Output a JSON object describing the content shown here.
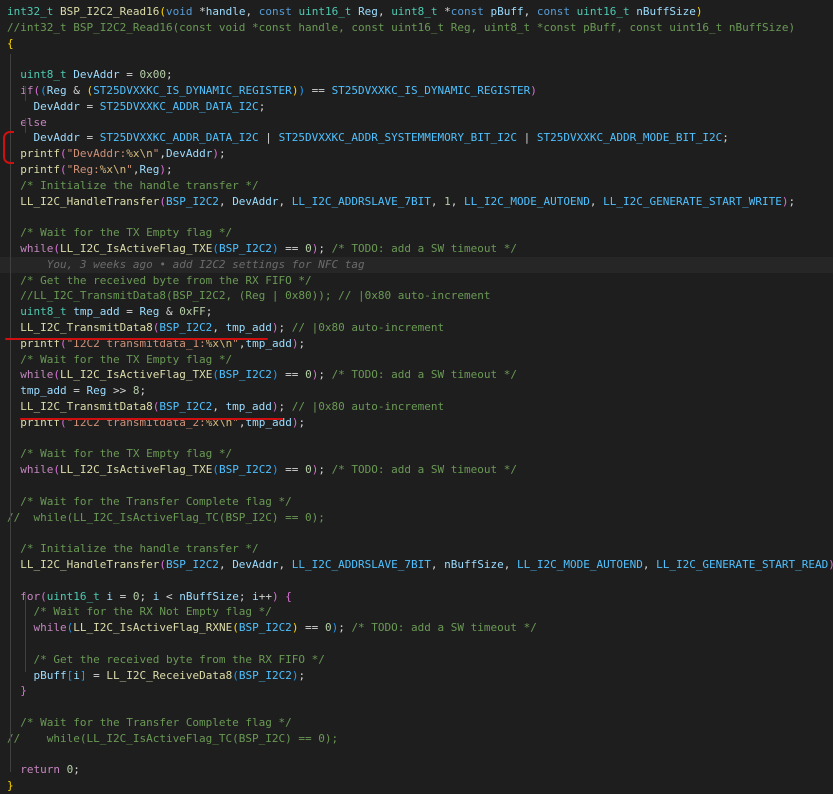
{
  "editor": {
    "colors": {
      "background": "#1e1e1e",
      "text": "#d4d4d4",
      "keyword": "#569cd6",
      "type": "#4ec9b0",
      "function": "#dcdcaa",
      "variable": "#9cdcfe",
      "macro": "#4fc1ff",
      "string": "#ce9178",
      "number": "#b5cea8",
      "comment": "#6a9955",
      "control": "#c586c0",
      "escape": "#d7ba7d",
      "bracket1": "#ffd700",
      "bracket2": "#da70d6",
      "bracket3": "#179fff",
      "blame": "#6b6b6b",
      "annotation": "#d01010"
    },
    "lines": [
      [
        [
          "type",
          "int32_t"
        ],
        [
          "text",
          " "
        ],
        [
          "function",
          "BSP_I2C2_Read16"
        ],
        [
          "bracket1",
          "("
        ],
        [
          "keyword",
          "void"
        ],
        [
          "text",
          " *"
        ],
        [
          "variable",
          "handle"
        ],
        [
          "text",
          ", "
        ],
        [
          "keyword",
          "const"
        ],
        [
          "text",
          " "
        ],
        [
          "type",
          "uint16_t"
        ],
        [
          "text",
          " "
        ],
        [
          "variable",
          "Reg"
        ],
        [
          "text",
          ", "
        ],
        [
          "type",
          "uint8_t"
        ],
        [
          "text",
          " *"
        ],
        [
          "keyword",
          "const"
        ],
        [
          "text",
          " "
        ],
        [
          "variable",
          "pBuff"
        ],
        [
          "text",
          ", "
        ],
        [
          "keyword",
          "const"
        ],
        [
          "text",
          " "
        ],
        [
          "type",
          "uint16_t"
        ],
        [
          "text",
          " "
        ],
        [
          "variable",
          "nBuffSize"
        ],
        [
          "bracket1",
          ")"
        ]
      ],
      [
        [
          "comment",
          "//int32_t BSP_I2C2_Read16(const void *const handle, const uint16_t Reg, uint8_t *const pBuff, const uint16_t nBuffSize)"
        ]
      ],
      [
        [
          "bracket1",
          "{"
        ]
      ],
      [],
      [
        [
          "text",
          "  "
        ],
        [
          "type",
          "uint8_t"
        ],
        [
          "text",
          " "
        ],
        [
          "variable",
          "DevAddr"
        ],
        [
          "text",
          " = "
        ],
        [
          "number",
          "0x00"
        ],
        [
          "text",
          ";"
        ]
      ],
      [
        [
          "text",
          "  "
        ],
        [
          "control",
          "if"
        ],
        [
          "bracket2",
          "("
        ],
        [
          "bracket3",
          "("
        ],
        [
          "variable",
          "Reg"
        ],
        [
          "text",
          " & "
        ],
        [
          "bracket1",
          "("
        ],
        [
          "macro",
          "ST25DVXXKC_IS_DYNAMIC_REGISTER"
        ],
        [
          "bracket1",
          ")"
        ],
        [
          "bracket3",
          ")"
        ],
        [
          "text",
          " == "
        ],
        [
          "macro",
          "ST25DVXXKC_IS_DYNAMIC_REGISTER"
        ],
        [
          "bracket2",
          ")"
        ]
      ],
      [
        [
          "text",
          "    "
        ],
        [
          "variable",
          "DevAddr"
        ],
        [
          "text",
          " = "
        ],
        [
          "macro",
          "ST25DVXXKC_ADDR_DATA_I2C"
        ],
        [
          "text",
          ";"
        ]
      ],
      [
        [
          "text",
          "  "
        ],
        [
          "control",
          "else"
        ]
      ],
      [
        [
          "text",
          "    "
        ],
        [
          "variable",
          "DevAddr"
        ],
        [
          "text",
          " = "
        ],
        [
          "macro",
          "ST25DVXXKC_ADDR_DATA_I2C"
        ],
        [
          "text",
          " | "
        ],
        [
          "macro",
          "ST25DVXXKC_ADDR_SYSTEMMEMORY_BIT_I2C"
        ],
        [
          "text",
          " | "
        ],
        [
          "macro",
          "ST25DVXXKC_ADDR_MODE_BIT_I2C"
        ],
        [
          "text",
          ";"
        ]
      ],
      [
        [
          "text",
          "  "
        ],
        [
          "function",
          "printf"
        ],
        [
          "bracket2",
          "("
        ],
        [
          "string",
          "\"DevAddr:"
        ],
        [
          "escape",
          "%x\\n"
        ],
        [
          "string",
          "\""
        ],
        [
          "text",
          ","
        ],
        [
          "variable",
          "DevAddr"
        ],
        [
          "bracket2",
          ")"
        ],
        [
          "text",
          ";"
        ]
      ],
      [
        [
          "text",
          "  "
        ],
        [
          "function",
          "printf"
        ],
        [
          "bracket2",
          "("
        ],
        [
          "string",
          "\"Reg:"
        ],
        [
          "escape",
          "%x\\n"
        ],
        [
          "string",
          "\""
        ],
        [
          "text",
          ","
        ],
        [
          "variable",
          "Reg"
        ],
        [
          "bracket2",
          ")"
        ],
        [
          "text",
          ";"
        ]
      ],
      [
        [
          "text",
          "  "
        ],
        [
          "comment",
          "/* Initialize the handle transfer */"
        ]
      ],
      [
        [
          "text",
          "  "
        ],
        [
          "function",
          "LL_I2C_HandleTransfer"
        ],
        [
          "bracket2",
          "("
        ],
        [
          "macro",
          "BSP_I2C2"
        ],
        [
          "text",
          ", "
        ],
        [
          "variable",
          "DevAddr"
        ],
        [
          "text",
          ", "
        ],
        [
          "macro",
          "LL_I2C_ADDRSLAVE_7BIT"
        ],
        [
          "text",
          ", "
        ],
        [
          "number",
          "1"
        ],
        [
          "text",
          ", "
        ],
        [
          "macro",
          "LL_I2C_MODE_AUTOEND"
        ],
        [
          "text",
          ", "
        ],
        [
          "macro",
          "LL_I2C_GENERATE_START_WRITE"
        ],
        [
          "bracket2",
          ")"
        ],
        [
          "text",
          ";"
        ]
      ],
      [],
      [
        [
          "text",
          "  "
        ],
        [
          "comment",
          "/* Wait for the TX Empty flag */"
        ]
      ],
      [
        [
          "text",
          "  "
        ],
        [
          "control",
          "while"
        ],
        [
          "bracket2",
          "("
        ],
        [
          "function",
          "LL_I2C_IsActiveFlag_TXE"
        ],
        [
          "bracket3",
          "("
        ],
        [
          "macro",
          "BSP_I2C2"
        ],
        [
          "bracket3",
          ")"
        ],
        [
          "text",
          " == "
        ],
        [
          "number",
          "0"
        ],
        [
          "bracket2",
          ")"
        ],
        [
          "text",
          "; "
        ],
        [
          "comment",
          "/* TODO: add a SW timeout */"
        ]
      ],
      [
        [
          "text",
          "      "
        ],
        [
          "blame",
          "You, 3 weeks ago • add I2C2 settings for NFC tag"
        ]
      ],
      [
        [
          "text",
          "  "
        ],
        [
          "comment",
          "/* Get the received byte from the RX FIFO */"
        ]
      ],
      [
        [
          "text",
          "  "
        ],
        [
          "comment",
          "//LL_I2C_TransmitData8(BSP_I2C2, (Reg | 0x80)); // |0x80 auto-increment"
        ]
      ],
      [
        [
          "text",
          "  "
        ],
        [
          "type",
          "uint8_t"
        ],
        [
          "text",
          " "
        ],
        [
          "variable",
          "tmp_add"
        ],
        [
          "text",
          " = "
        ],
        [
          "variable",
          "Reg"
        ],
        [
          "text",
          " & "
        ],
        [
          "number",
          "0xFF"
        ],
        [
          "text",
          ";"
        ]
      ],
      [
        [
          "text",
          "  "
        ],
        [
          "function",
          "LL_I2C_TransmitData8"
        ],
        [
          "bracket2",
          "("
        ],
        [
          "macro",
          "BSP_I2C2"
        ],
        [
          "text",
          ", "
        ],
        [
          "variable",
          "tmp_add"
        ],
        [
          "bracket2",
          ")"
        ],
        [
          "text",
          "; "
        ],
        [
          "comment",
          "// |0x80 auto-increment"
        ]
      ],
      [
        [
          "text",
          "  "
        ],
        [
          "function",
          "printf"
        ],
        [
          "bracket2",
          "("
        ],
        [
          "string",
          "\"I2C2 transmitdata_1:"
        ],
        [
          "escape",
          "%x\\n"
        ],
        [
          "string",
          "\""
        ],
        [
          "text",
          ","
        ],
        [
          "variable",
          "tmp_add"
        ],
        [
          "bracket2",
          ")"
        ],
        [
          "text",
          ";"
        ]
      ],
      [
        [
          "text",
          "  "
        ],
        [
          "comment",
          "/* Wait for the TX Empty flag */"
        ]
      ],
      [
        [
          "text",
          "  "
        ],
        [
          "control",
          "while"
        ],
        [
          "bracket2",
          "("
        ],
        [
          "function",
          "LL_I2C_IsActiveFlag_TXE"
        ],
        [
          "bracket3",
          "("
        ],
        [
          "macro",
          "BSP_I2C2"
        ],
        [
          "bracket3",
          ")"
        ],
        [
          "text",
          " == "
        ],
        [
          "number",
          "0"
        ],
        [
          "bracket2",
          ")"
        ],
        [
          "text",
          "; "
        ],
        [
          "comment",
          "/* TODO: add a SW timeout */"
        ]
      ],
      [
        [
          "text",
          "  "
        ],
        [
          "variable",
          "tmp_add"
        ],
        [
          "text",
          " = "
        ],
        [
          "variable",
          "Reg"
        ],
        [
          "text",
          " >> "
        ],
        [
          "number",
          "8"
        ],
        [
          "text",
          ";"
        ]
      ],
      [
        [
          "text",
          "  "
        ],
        [
          "function",
          "LL_I2C_TransmitData8"
        ],
        [
          "bracket2",
          "("
        ],
        [
          "macro",
          "BSP_I2C2"
        ],
        [
          "text",
          ", "
        ],
        [
          "variable",
          "tmp_add"
        ],
        [
          "bracket2",
          ")"
        ],
        [
          "text",
          "; "
        ],
        [
          "comment",
          "// |0x80 auto-increment"
        ]
      ],
      [
        [
          "text",
          "  "
        ],
        [
          "function",
          "printf"
        ],
        [
          "bracket2",
          "("
        ],
        [
          "string",
          "\"I2C2 transmitdata_2:"
        ],
        [
          "escape",
          "%x\\n"
        ],
        [
          "string",
          "\""
        ],
        [
          "text",
          ","
        ],
        [
          "variable",
          "tmp_add"
        ],
        [
          "bracket2",
          ")"
        ],
        [
          "text",
          ";"
        ]
      ],
      [],
      [
        [
          "text",
          "  "
        ],
        [
          "comment",
          "/* Wait for the TX Empty flag */"
        ]
      ],
      [
        [
          "text",
          "  "
        ],
        [
          "control",
          "while"
        ],
        [
          "bracket2",
          "("
        ],
        [
          "function",
          "LL_I2C_IsActiveFlag_TXE"
        ],
        [
          "bracket3",
          "("
        ],
        [
          "macro",
          "BSP_I2C2"
        ],
        [
          "bracket3",
          ")"
        ],
        [
          "text",
          " == "
        ],
        [
          "number",
          "0"
        ],
        [
          "bracket2",
          ")"
        ],
        [
          "text",
          "; "
        ],
        [
          "comment",
          "/* TODO: add a SW timeout */"
        ]
      ],
      [],
      [
        [
          "text",
          "  "
        ],
        [
          "comment",
          "/* Wait for the Transfer Complete flag */"
        ]
      ],
      [
        [
          "comment",
          "//  while(LL_I2C_IsActiveFlag_TC(BSP_I2C) == 0);"
        ]
      ],
      [],
      [
        [
          "text",
          "  "
        ],
        [
          "comment",
          "/* Initialize the handle transfer */"
        ]
      ],
      [
        [
          "text",
          "  "
        ],
        [
          "function",
          "LL_I2C_HandleTransfer"
        ],
        [
          "bracket2",
          "("
        ],
        [
          "macro",
          "BSP_I2C2"
        ],
        [
          "text",
          ", "
        ],
        [
          "variable",
          "DevAddr"
        ],
        [
          "text",
          ", "
        ],
        [
          "macro",
          "LL_I2C_ADDRSLAVE_7BIT"
        ],
        [
          "text",
          ", "
        ],
        [
          "variable",
          "nBuffSize"
        ],
        [
          "text",
          ", "
        ],
        [
          "macro",
          "LL_I2C_MODE_AUTOEND"
        ],
        [
          "text",
          ", "
        ],
        [
          "macro",
          "LL_I2C_GENERATE_START_READ"
        ],
        [
          "bracket2",
          ")"
        ],
        [
          "text",
          ";"
        ]
      ],
      [],
      [
        [
          "text",
          "  "
        ],
        [
          "control",
          "for"
        ],
        [
          "bracket2",
          "("
        ],
        [
          "type",
          "uint16_t"
        ],
        [
          "text",
          " "
        ],
        [
          "variable",
          "i"
        ],
        [
          "text",
          " = "
        ],
        [
          "number",
          "0"
        ],
        [
          "text",
          "; "
        ],
        [
          "variable",
          "i"
        ],
        [
          "text",
          " < "
        ],
        [
          "variable",
          "nBuffSize"
        ],
        [
          "text",
          "; "
        ],
        [
          "variable",
          "i"
        ],
        [
          "text",
          "++"
        ],
        [
          "bracket2",
          ")"
        ],
        [
          "text",
          " "
        ],
        [
          "bracket2",
          "{"
        ]
      ],
      [
        [
          "text",
          "    "
        ],
        [
          "comment",
          "/* Wait for the RX Not Empty flag */"
        ]
      ],
      [
        [
          "text",
          "    "
        ],
        [
          "control",
          "while"
        ],
        [
          "bracket3",
          "("
        ],
        [
          "function",
          "LL_I2C_IsActiveFlag_RXNE"
        ],
        [
          "bracket1",
          "("
        ],
        [
          "macro",
          "BSP_I2C2"
        ],
        [
          "bracket1",
          ")"
        ],
        [
          "text",
          " == "
        ],
        [
          "number",
          "0"
        ],
        [
          "bracket3",
          ")"
        ],
        [
          "text",
          "; "
        ],
        [
          "comment",
          "/* TODO: add a SW timeout */"
        ]
      ],
      [],
      [
        [
          "text",
          "    "
        ],
        [
          "comment",
          "/* Get the received byte from the RX FIFO */"
        ]
      ],
      [
        [
          "text",
          "    "
        ],
        [
          "variable",
          "pBuff"
        ],
        [
          "bracket3",
          "["
        ],
        [
          "variable",
          "i"
        ],
        [
          "bracket3",
          "]"
        ],
        [
          "text",
          " = "
        ],
        [
          "function",
          "LL_I2C_ReceiveData8"
        ],
        [
          "bracket3",
          "("
        ],
        [
          "macro",
          "BSP_I2C2"
        ],
        [
          "bracket3",
          ")"
        ],
        [
          "text",
          ";"
        ]
      ],
      [
        [
          "text",
          "  "
        ],
        [
          "bracket2",
          "}"
        ]
      ],
      [],
      [
        [
          "text",
          "  "
        ],
        [
          "comment",
          "/* Wait for the Transfer Complete flag */"
        ]
      ],
      [
        [
          "comment",
          "//    while(LL_I2C_IsActiveFlag_TC(BSP_I2C) == 0);"
        ]
      ],
      [],
      [
        [
          "text",
          "  "
        ],
        [
          "control",
          "return"
        ],
        [
          "text",
          " "
        ],
        [
          "number",
          "0"
        ],
        [
          "text",
          ";"
        ]
      ],
      [
        [
          "bracket1",
          "}"
        ]
      ]
    ]
  }
}
